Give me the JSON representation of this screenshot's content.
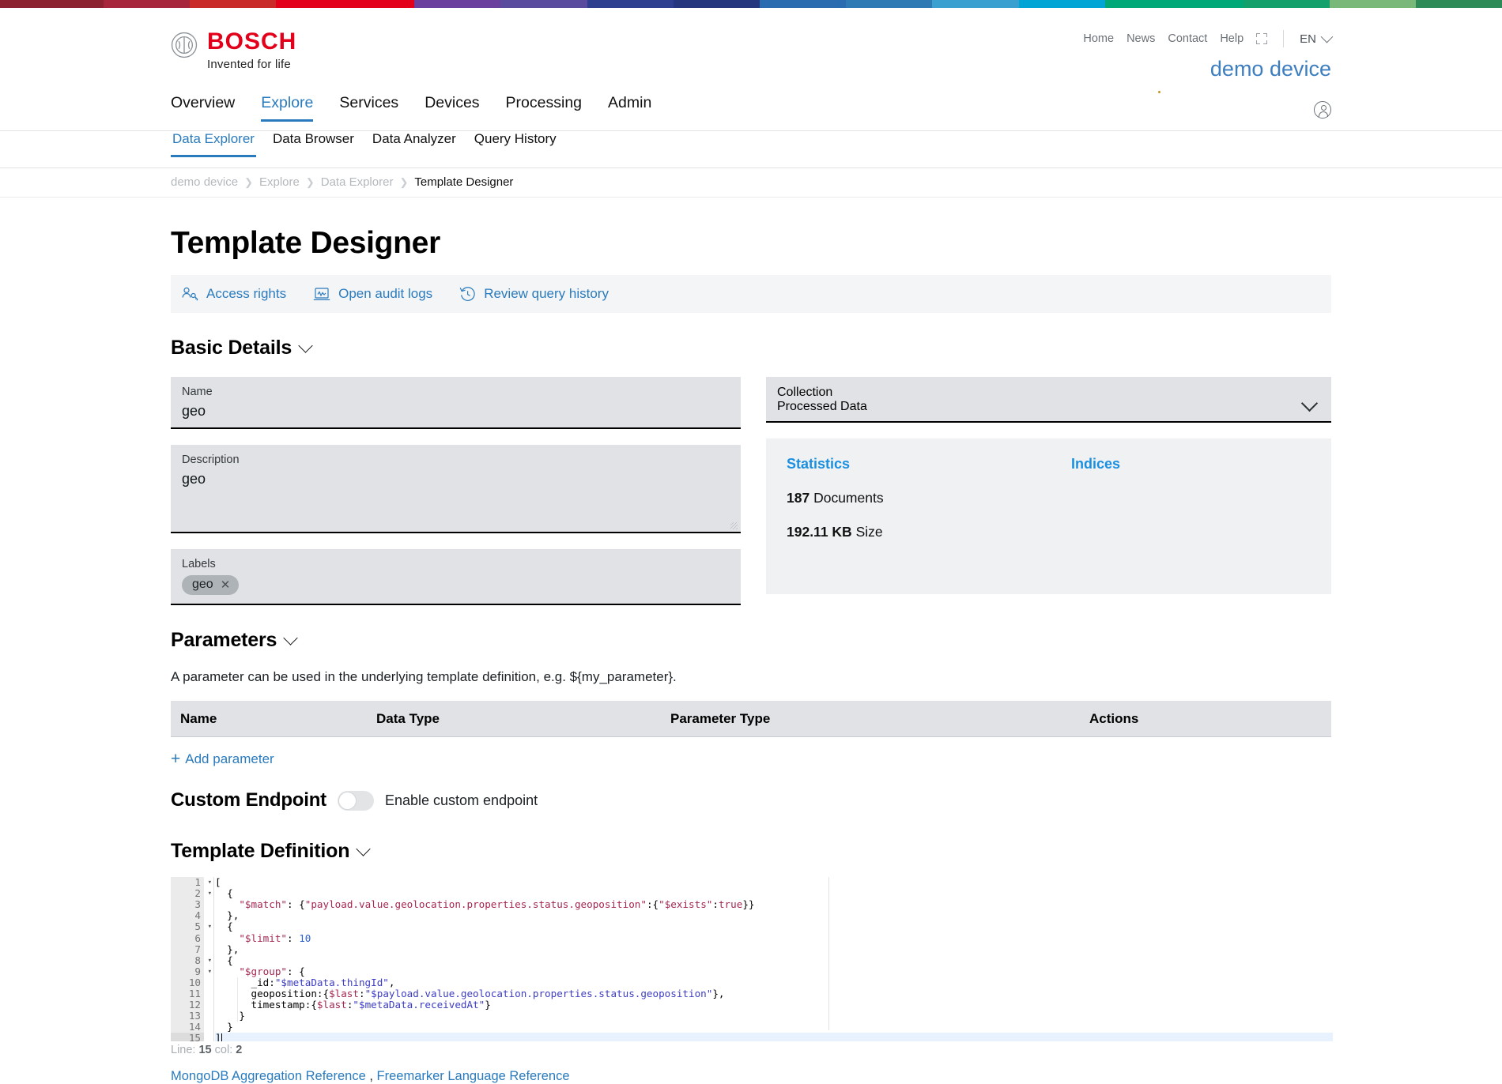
{
  "brand": {
    "wordmark": "BOSCH",
    "tagline": "Invented for life",
    "strip_colors": [
      "#8c2230",
      "#a7263c",
      "#c92a2a",
      "#e2001a",
      "#6b3f9e",
      "#5b4b9e",
      "#2f3f8f",
      "#25357e",
      "#2b6cb0",
      "#2f79b5",
      "#3aa0cf",
      "#00a5d6",
      "#00a878",
      "#13a06a",
      "#7ab87a",
      "#2e8b57"
    ]
  },
  "meta_nav": {
    "links": [
      "Home",
      "News",
      "Contact",
      "Help"
    ],
    "external_icon": "external-window-icon",
    "language": "EN",
    "language_chevron": "chevron-down-icon"
  },
  "device_name": "demo device",
  "account_icon": "account-circle-icon",
  "main_nav": {
    "items": [
      {
        "label": "Overview",
        "active": false
      },
      {
        "label": "Explore",
        "active": true
      },
      {
        "label": "Services",
        "active": false
      },
      {
        "label": "Devices",
        "active": false
      },
      {
        "label": "Processing",
        "active": false
      },
      {
        "label": "Admin",
        "active": false
      }
    ]
  },
  "sub_nav": {
    "items": [
      {
        "label": "Data Explorer",
        "active": true
      },
      {
        "label": "Data Browser",
        "active": false
      },
      {
        "label": "Data Analyzer",
        "active": false
      },
      {
        "label": "Query History",
        "active": false
      }
    ]
  },
  "breadcrumb": {
    "items": [
      "demo device",
      "Explore",
      "Data Explorer",
      "Template Designer"
    ],
    "separator": "❯"
  },
  "page_title": "Template Designer",
  "action_bar": {
    "actions": [
      {
        "label": "Access rights",
        "icon": "users-key-icon"
      },
      {
        "label": "Open audit logs",
        "icon": "audit-log-icon"
      },
      {
        "label": "Review query history",
        "icon": "history-clock-icon"
      }
    ]
  },
  "basic_details": {
    "heading": "Basic Details",
    "collapse_icon": "chevron-down-icon",
    "name": {
      "label": "Name",
      "value": "geo"
    },
    "description": {
      "label": "Description",
      "value": "geo"
    },
    "labels": {
      "label": "Labels",
      "chips": [
        {
          "text": "geo",
          "remove_icon": "close-icon"
        }
      ]
    },
    "collection": {
      "label": "Collection",
      "value": "Processed Data",
      "chevron": "chevron-down-icon"
    },
    "statistics": {
      "heading": "Statistics",
      "documents_value": "187",
      "documents_label": "Documents",
      "size_value": "192.11 KB",
      "size_label": "Size"
    },
    "indices": {
      "heading": "Indices"
    }
  },
  "parameters": {
    "heading": "Parameters",
    "collapse_icon": "chevron-down-icon",
    "helper_text": "A parameter can be used in the underlying template definition, e.g. ${my_parameter}.",
    "columns": [
      "Name",
      "Data Type",
      "Parameter Type",
      "Actions"
    ],
    "rows": [],
    "add_label": "Add parameter",
    "add_icon": "plus-icon"
  },
  "custom_endpoint": {
    "heading": "Custom Endpoint",
    "toggle_label": "Enable custom endpoint",
    "enabled": false
  },
  "template_definition": {
    "heading": "Template Definition",
    "collapse_icon": "chevron-down-icon",
    "lines": [
      {
        "n": 1,
        "fold": true,
        "text": "["
      },
      {
        "n": 2,
        "fold": true,
        "text": "  {"
      },
      {
        "n": 3,
        "fold": false,
        "text": "    \"$match\": {\"payload.value.geolocation.properties.status.geoposition\":{\"$exists\":true}}"
      },
      {
        "n": 4,
        "fold": false,
        "text": "  },"
      },
      {
        "n": 5,
        "fold": true,
        "text": "  {"
      },
      {
        "n": 6,
        "fold": false,
        "text": "    \"$limit\": 10"
      },
      {
        "n": 7,
        "fold": false,
        "text": "  },"
      },
      {
        "n": 8,
        "fold": true,
        "text": "  {"
      },
      {
        "n": 9,
        "fold": true,
        "text": "    \"$group\": {"
      },
      {
        "n": 10,
        "fold": false,
        "text": "      _id:\"$metaData.thingId\","
      },
      {
        "n": 11,
        "fold": false,
        "text": "      geoposition:{$last:\"$payload.value.geolocation.properties.status.geoposition\"},"
      },
      {
        "n": 12,
        "fold": false,
        "text": "      timestamp:{$last:\"$metaData.receivedAt\"}"
      },
      {
        "n": 13,
        "fold": false,
        "text": "    }"
      },
      {
        "n": 14,
        "fold": false,
        "text": "  }"
      },
      {
        "n": 15,
        "fold": false,
        "text": "]",
        "active": true
      }
    ],
    "status": {
      "prefix": "Line:",
      "line": "15",
      "col_prefix": "col:",
      "col": "2"
    },
    "reference_links": [
      {
        "label": "MongoDB Aggregation Reference"
      },
      {
        "label": "Freemarker Language Reference"
      }
    ],
    "link_separator": ","
  }
}
